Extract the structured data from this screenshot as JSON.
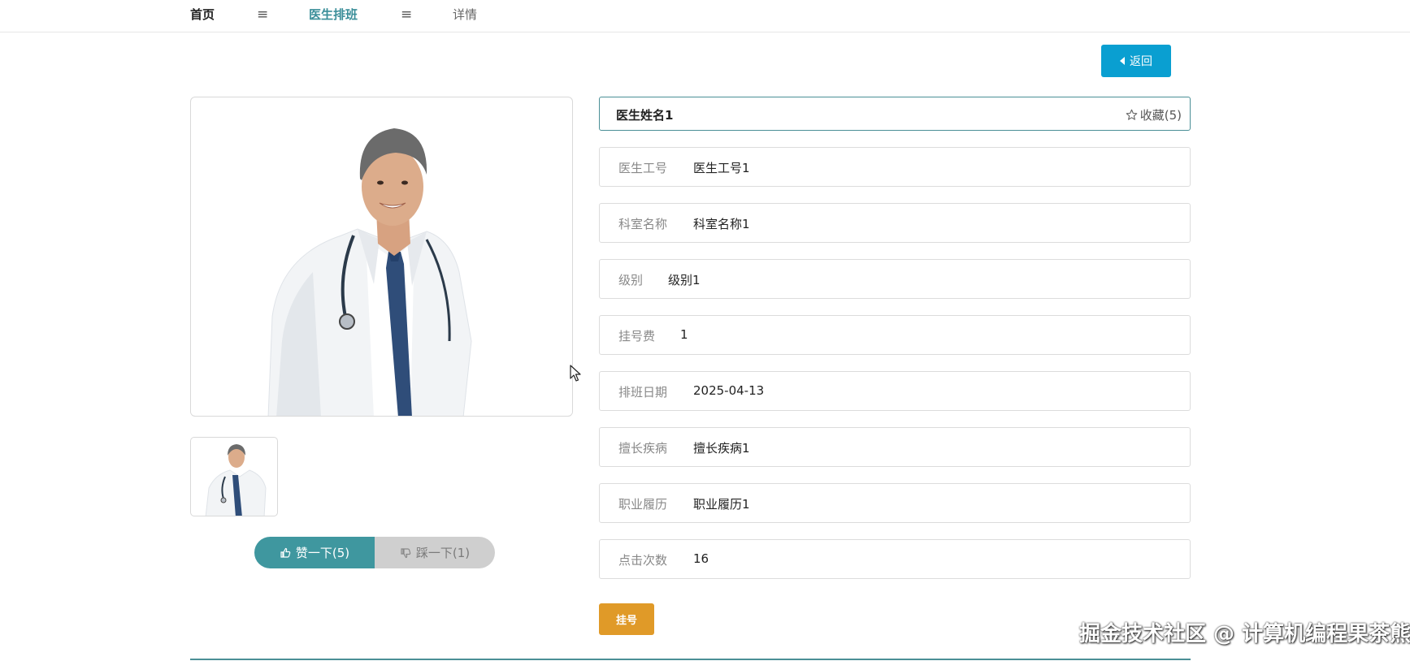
{
  "nav": {
    "home": "首页",
    "separator": "≡",
    "section": "医生排班",
    "detail": "详情"
  },
  "back_button": "返回",
  "doctor": {
    "name": "医生姓名1",
    "favorite_label": "收藏(5)"
  },
  "fields": [
    {
      "label": "医生工号",
      "value": "医生工号1"
    },
    {
      "label": "科室名称",
      "value": "科室名称1"
    },
    {
      "label": "级别",
      "value": "级别1"
    },
    {
      "label": "挂号费",
      "value": "1"
    },
    {
      "label": "排班日期",
      "value": "2025-04-13"
    },
    {
      "label": "擅长疾病",
      "value": "擅长疾病1"
    },
    {
      "label": "职业履历",
      "value": "职业履历1"
    },
    {
      "label": "点击次数",
      "value": "16"
    }
  ],
  "votes": {
    "like_label": "赞一下(5)",
    "dislike_label": "踩一下(1)"
  },
  "register_button": "挂号",
  "watermark": "掘金技术社区 @ 计算机编程果茶熊",
  "colors": {
    "accent": "#3f979f",
    "back_button": "#0a9fd1",
    "register_button": "#e09a28"
  },
  "icons": {
    "menu": "menu-icon",
    "back": "caret-left-icon",
    "favorite": "star-outline-icon",
    "like": "thumbs-up-icon",
    "dislike": "thumbs-down-icon"
  }
}
